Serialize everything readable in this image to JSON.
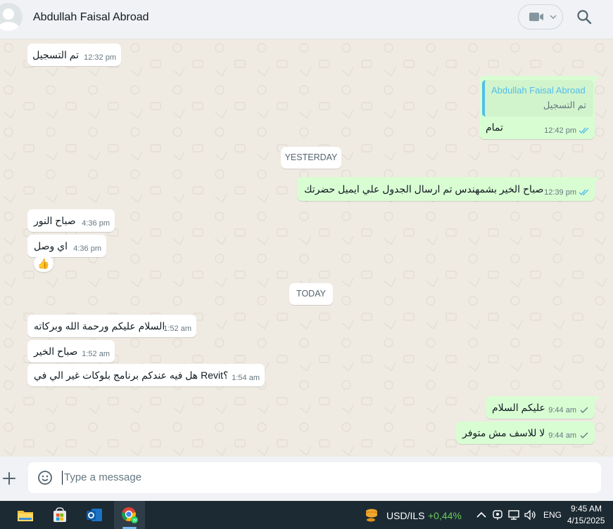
{
  "header": {
    "contact_name": "Abdullah Faisal Abroad",
    "video_icon": "video-call-icon",
    "search_icon": "search-icon"
  },
  "messages": [
    {
      "dir": "in",
      "text": "تم التسجيل",
      "time": "12:32 pm"
    },
    {
      "dir": "out",
      "quote_name": "Abdullah Faisal Abroad",
      "quote_text": "تم التسجيل",
      "text": "تمام",
      "time": "12:42 pm",
      "status": "read"
    },
    {
      "dir": "out",
      "text": "صباح الخير بشمهندس تم ارسال الجدول علي ايميل حضرتك",
      "time": "12:39 pm",
      "status": "read"
    },
    {
      "dir": "in",
      "text": "صباح النور",
      "time": "4:36 pm"
    },
    {
      "dir": "in",
      "text": "اي وصل",
      "time": "4:36 pm",
      "reaction": "👍"
    },
    {
      "dir": "in",
      "text": "السلام عليكم ورحمة الله وبركاته",
      "time": "1:52 am"
    },
    {
      "dir": "in",
      "text": "صباح الخير",
      "time": "1:52 am"
    },
    {
      "dir": "in",
      "text": "هل فيه عندكم برنامج بلوكات غير الي في Revit؟",
      "time": "1:54 am"
    },
    {
      "dir": "out",
      "text": "عليكم السلام",
      "time": "9:44 am",
      "status": "sent"
    },
    {
      "dir": "out",
      "text": "لا للاسف مش متوفر",
      "time": "9:44 am",
      "status": "sent"
    }
  ],
  "date_chips": [
    "YESTERDAY",
    "TODAY"
  ],
  "composer": {
    "placeholder": "Type a message",
    "plus_icon": "plus-icon",
    "emoji_icon": "emoji-icon"
  },
  "taskbar": {
    "apps": [
      "file-explorer-icon",
      "microsoft-store-icon",
      "outlook-icon",
      "chrome-whatsapp-icon"
    ],
    "ticker_label": "USD/ILS",
    "ticker_change": "+0,44%",
    "language": "ENG",
    "time": "9:45 AM",
    "date": "4/15/2025",
    "colors": {
      "positive": "#6ccb5f",
      "background": "#1c2a33"
    }
  },
  "colors": {
    "incoming_bubble": "#ffffff",
    "outgoing_bubble": "#d9fdd3",
    "read_tick": "#53bdeb",
    "chat_background": "#efeae2"
  }
}
